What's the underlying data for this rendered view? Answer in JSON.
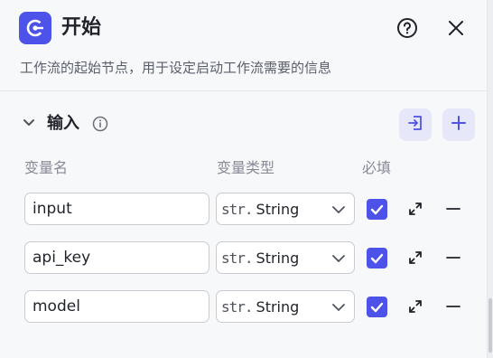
{
  "node": {
    "title": "开始",
    "icon": "start-node-icon",
    "description": "工作流的起始节点，用于设定启动工作流需要的信息",
    "accent_color": "#4d53e8"
  },
  "header": {
    "help_icon": "question-circle-icon",
    "close_icon": "close-icon"
  },
  "section": {
    "title": "输入",
    "expanded": true,
    "info_icon": "info-icon",
    "import_icon": "import-icon",
    "add_icon": "plus-icon"
  },
  "columns": {
    "name": "变量名",
    "type": "变量类型",
    "required": "必填"
  },
  "variables": [
    {
      "name": "input",
      "type_prefix": "str.",
      "type": "String",
      "required": true
    },
    {
      "name": "api_key",
      "type_prefix": "str.",
      "type": "String",
      "required": true
    },
    {
      "name": "model",
      "type_prefix": "str.",
      "type": "String",
      "required": true
    }
  ]
}
